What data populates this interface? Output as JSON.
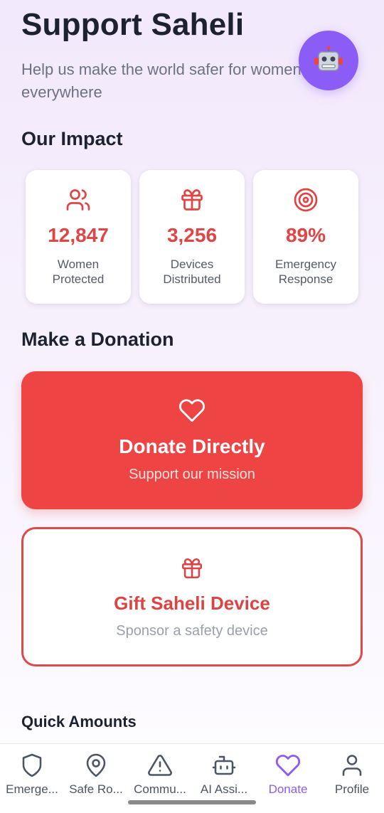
{
  "header": {
    "title": "Support Saheli",
    "subtitle_line1": "Help us make the world safer for women",
    "subtitle_line2": "everywhere",
    "assistant_icon": "robot-icon"
  },
  "impact": {
    "heading": "Our Impact",
    "stats": [
      {
        "value": "12,847",
        "label_line1": "Women",
        "label_line2": "Protected",
        "icon": "users-icon"
      },
      {
        "value": "3,256",
        "label_line1": "Devices",
        "label_line2": "Distributed",
        "icon": "gift-icon"
      },
      {
        "value": "89%",
        "label_line1": "Emergency",
        "label_line2": "Response",
        "icon": "target-icon"
      }
    ]
  },
  "donation": {
    "heading": "Make a Donation",
    "direct": {
      "title": "Donate Directly",
      "subtitle": "Support our mission",
      "icon": "heart-icon"
    },
    "gift": {
      "title": "Gift Saheli Device",
      "subtitle": "Sponsor a safety device",
      "icon": "gift-icon"
    }
  },
  "quick_amounts": {
    "heading": "Quick Amounts"
  },
  "colors": {
    "accent": "#8b5cf6",
    "primary_red": "#ef4444",
    "stat_red": "#e04444"
  },
  "bottom_nav": {
    "items": [
      {
        "label": "Emerge...",
        "icon": "shield-icon"
      },
      {
        "label": "Safe Ro...",
        "icon": "map-pin-icon"
      },
      {
        "label": "Commu...",
        "icon": "warning-icon"
      },
      {
        "label": "AI Assi...",
        "icon": "bot-icon"
      },
      {
        "label": "Donate",
        "icon": "heart-icon",
        "active": true
      },
      {
        "label": "Profile",
        "icon": "user-icon"
      }
    ]
  }
}
